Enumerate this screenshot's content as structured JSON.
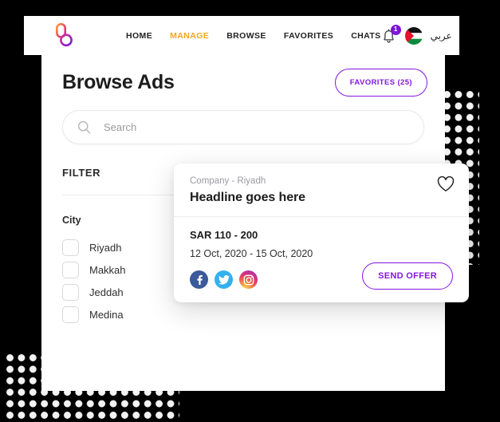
{
  "topbar": {
    "logo_name": "brand-logo",
    "nav_items": [
      {
        "label": "HOME",
        "active": false
      },
      {
        "label": "MANAGE",
        "active": true
      },
      {
        "label": "BROWSE",
        "active": false
      },
      {
        "label": "FAVORITES",
        "active": false
      },
      {
        "label": "CHATS",
        "active": false
      }
    ],
    "notification": {
      "icon": "bell-icon",
      "count": "1",
      "badge_color": "#7d16d8"
    },
    "flag": {
      "icon": "palestine-flag-icon",
      "colors": [
        "#000000",
        "#ffffff",
        "#0f8a3d",
        "#e8112d"
      ]
    },
    "language_toggle": "عربي",
    "active_color": "#f6a623"
  },
  "page": {
    "title": "Browse Ads",
    "favorites_button": "FAVORITES (25)",
    "accent_color": "#8316e0"
  },
  "search": {
    "icon": "search-icon",
    "placeholder": "Search",
    "value": ""
  },
  "filter": {
    "heading": "FILTER",
    "groups": [
      {
        "label": "City",
        "options": [
          {
            "label": "Riyadh",
            "checked": false
          },
          {
            "label": "Makkah",
            "checked": false
          },
          {
            "label": "Jeddah",
            "checked": false
          },
          {
            "label": "Medina",
            "checked": false
          }
        ]
      }
    ]
  },
  "ad_card": {
    "company": "Company - Riyadh",
    "headline": "Headline goes here",
    "price": "SAR 110 - 200",
    "dates": "12 Oct, 2020 - 15 Oct, 2020",
    "favorite_icon": "heart-outline-icon",
    "socials": [
      {
        "name": "facebook-icon",
        "color": "#3b5a9b"
      },
      {
        "name": "twitter-icon",
        "color": "#34b0ee"
      },
      {
        "name": "instagram-icon",
        "color": "#d62f7f"
      }
    ],
    "action_button": "SEND OFFER"
  },
  "decor": {
    "dot_pattern_color": "#f2f2f2",
    "backdrop_color": "#000000"
  }
}
